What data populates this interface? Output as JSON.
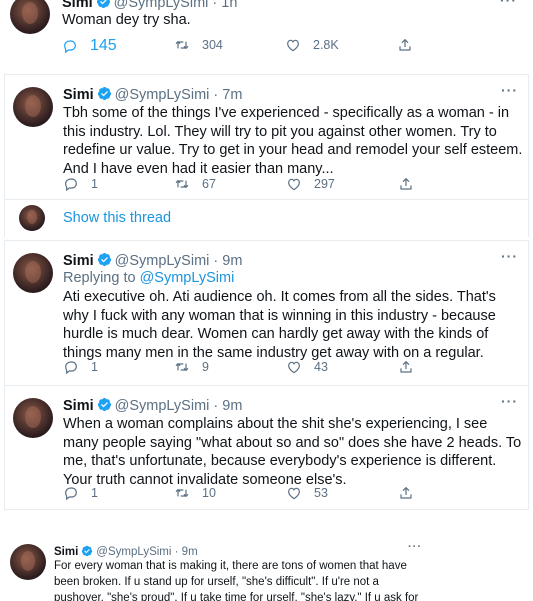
{
  "tweets": [
    {
      "name": "Simi",
      "handle": "@SympLySimi",
      "time": " · 1h",
      "body": "Woman dey try sha.",
      "reply_count": "145",
      "retweet_count": "304",
      "like_count": "2.8K"
    },
    {
      "name": "Simi",
      "handle": "@SympLySimi",
      "time": " · 7m",
      "body": "Tbh some of the things I've experienced  - specifically as a woman - in this industry. Lol. They will try to pit you against other women. Try to redefine ur value. Try to get in your head and remodel your self esteem. And I have even had it easier than many...",
      "reply_count": "1",
      "retweet_count": "67",
      "like_count": "297"
    },
    {
      "name": "Simi",
      "handle": "@SympLySimi",
      "time": " · 9m",
      "replying_label": "Replying to ",
      "replying_handle": "@SympLySimi",
      "body": "Ati executive oh. Ati audience oh. It comes from all the sides. That's why I fuck with any woman that is winning in this industry - because hurdle is much dear. Women can hardly get away with the kinds of things many men in the same industry get away with on a regular.",
      "reply_count": "1",
      "retweet_count": "9",
      "like_count": "43"
    },
    {
      "name": "Simi",
      "handle": "@SympLySimi",
      "time": " · 9m",
      "body": "When a woman complains about the shit she's experiencing, I see many people saying \"what about so and so\" does she have 2 heads. To me, that's unfortunate, because everybody's experience is different. Your truth cannot invalidate someone else's.",
      "reply_count": "1",
      "retweet_count": "10",
      "like_count": "53"
    },
    {
      "name": "Simi",
      "handle": "@SympLySimi",
      "time": " · 9m",
      "body": "For every woman that is making it, there are tons of women that have been broken. If u stand up for urself, \"she's difficult\". If u're not a pushover, \"she's proud\". If u take time for urself, \"she's lazy.\" If u ask for what you deserve,"
    }
  ],
  "show_thread": "Show this thread",
  "colors": {
    "accent": "#1da1f2",
    "link": "#1b95e0",
    "muted": "#5b7083",
    "border": "#e6ecf0"
  },
  "icons": {
    "verified": "verified-badge-icon",
    "reply": "reply-icon",
    "retweet": "retweet-icon",
    "like": "heart-icon",
    "share": "share-icon",
    "more": "more-icon"
  }
}
